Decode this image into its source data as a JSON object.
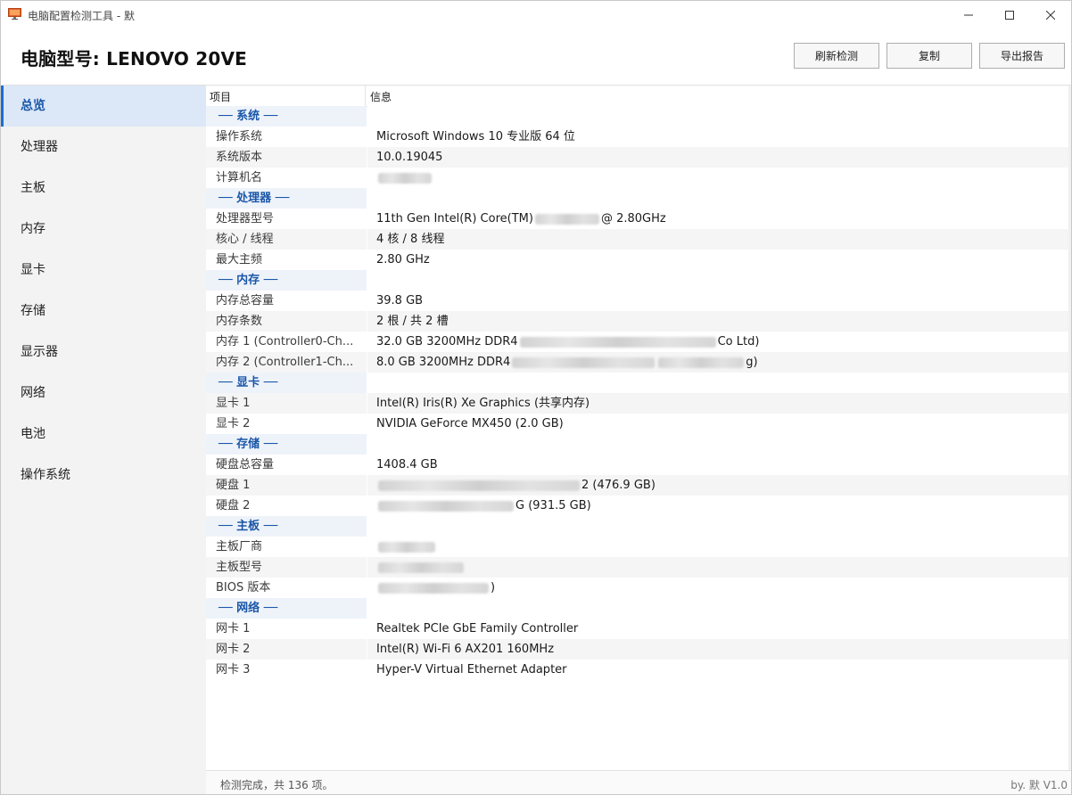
{
  "window": {
    "title": "电脑配置检测工具 - 默",
    "controls": [
      "minimize-icon",
      "maximize-icon",
      "close-icon"
    ]
  },
  "header": {
    "model_title": "电脑型号: LENOVO 20VE",
    "buttons": {
      "refresh": "刷新检测",
      "copy": "复制",
      "export": "导出报告"
    }
  },
  "sidebar": {
    "items": [
      {
        "label": "总览",
        "active": true
      },
      {
        "label": "处理器"
      },
      {
        "label": "主板"
      },
      {
        "label": "内存"
      },
      {
        "label": "显卡"
      },
      {
        "label": "存储"
      },
      {
        "label": "显示器"
      },
      {
        "label": "网络"
      },
      {
        "label": "电池"
      },
      {
        "label": "操作系统"
      }
    ]
  },
  "table": {
    "headers": [
      "项目",
      "信息"
    ],
    "rows": [
      {
        "type": "section",
        "label": "── 系统 ──"
      },
      {
        "label": "操作系统",
        "value": "Microsoft Windows 10 专业版 64 位"
      },
      {
        "label": "系统版本",
        "value": "10.0.19045"
      },
      {
        "label": "计算机名",
        "value": "",
        "redacted": true
      },
      {
        "type": "section",
        "label": "── 处理器 ──"
      },
      {
        "label": "处理器型号",
        "value": "11th Gen Intel(R) Core(TM)",
        "suffix": "@ 2.80GHz",
        "redacted": true
      },
      {
        "label": "核心 / 线程",
        "value": "4 核 / 8 线程"
      },
      {
        "label": "最大主频",
        "value": "2.80 GHz"
      },
      {
        "type": "section",
        "label": "── 内存 ──"
      },
      {
        "label": "内存总容量",
        "value": "39.8 GB"
      },
      {
        "label": "内存条数",
        "value": "2 根 / 共 2 槽"
      },
      {
        "label": "内存 1 (Controller0-Ch...",
        "value": "32.0 GB 3200MHz DDR4",
        "suffix": "Co Ltd)",
        "redacted": true
      },
      {
        "label": "内存 2 (Controller1-Ch...",
        "value": "8.0 GB 3200MHz DDR4",
        "suffix": "g)",
        "redacted": true
      },
      {
        "type": "section",
        "label": "── 显卡 ──"
      },
      {
        "label": "显卡 1",
        "value": "Intel(R) Iris(R) Xe Graphics  (共享内存)"
      },
      {
        "label": "显卡 2",
        "value": "NVIDIA GeForce MX450  (2.0 GB)"
      },
      {
        "type": "section",
        "label": "── 存储 ──"
      },
      {
        "label": "硬盘总容量",
        "value": "1408.4 GB"
      },
      {
        "label": "硬盘 1",
        "value": "",
        "suffix": "2 (476.9 GB)",
        "redacted": true
      },
      {
        "label": "硬盘 2",
        "value": "",
        "suffix": "G (931.5 GB)",
        "redacted": true
      },
      {
        "type": "section",
        "label": "── 主板 ──"
      },
      {
        "label": "主板厂商",
        "value": "",
        "redacted": true
      },
      {
        "label": "主板型号",
        "value": "",
        "redacted": true
      },
      {
        "label": "BIOS 版本",
        "value": "",
        "suffix": ")",
        "redacted": true
      },
      {
        "type": "section",
        "label": "── 网络 ──"
      },
      {
        "label": "网卡 1",
        "value": "Realtek PCIe GbE Family Controller"
      },
      {
        "label": "网卡 2",
        "value": "Intel(R) Wi-Fi 6 AX201 160MHz"
      },
      {
        "label": "网卡 3",
        "value": "Hyper-V Virtual Ethernet Adapter"
      }
    ]
  },
  "status": {
    "left": "检测完成，共 136 项。",
    "right": "by. 默 V1.0"
  },
  "colors": {
    "accent": "#1a6fd0",
    "section_text": "#1a56a8",
    "sidebar_bg": "#f3f3f3",
    "active_bg": "#dce8f7"
  }
}
